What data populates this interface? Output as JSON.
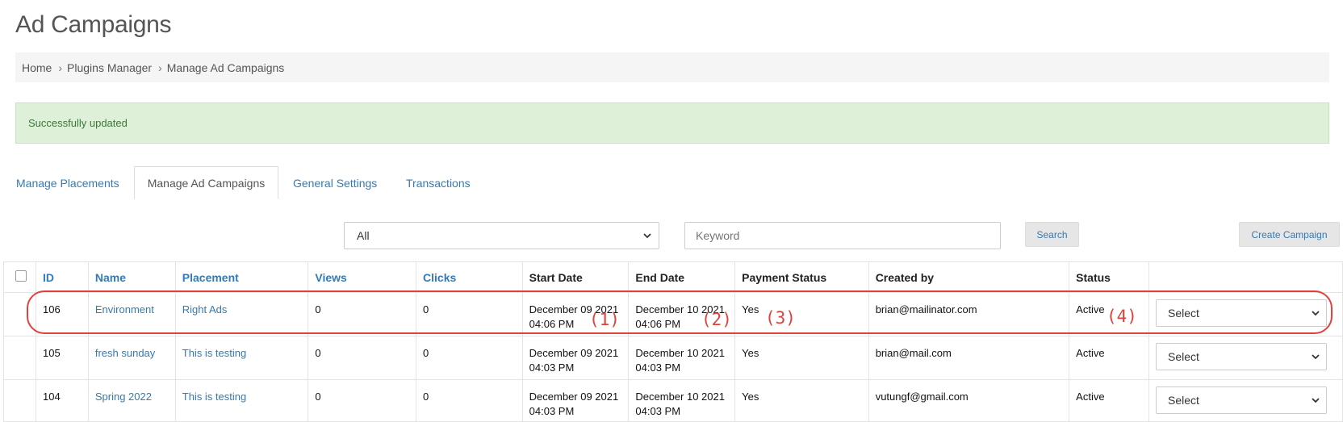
{
  "page": {
    "title": "Ad Campaigns"
  },
  "breadcrumb": {
    "items": [
      "Home",
      "Plugins Manager",
      "Manage Ad Campaigns"
    ],
    "separator": "›"
  },
  "alert": {
    "message": "Successfully updated",
    "color": "#dff0d8"
  },
  "tabs": [
    {
      "label": "Manage Placements",
      "active": false
    },
    {
      "label": "Manage Ad Campaigns",
      "active": true
    },
    {
      "label": "General Settings",
      "active": false
    },
    {
      "label": "Transactions",
      "active": false
    }
  ],
  "filters": {
    "status_select": {
      "value": "All"
    },
    "keyword": {
      "placeholder": "Keyword",
      "value": ""
    },
    "search_label": "Search",
    "create_label": "Create Campaign"
  },
  "table": {
    "headers": [
      "ID",
      "Name",
      "Placement",
      "Views",
      "Clicks",
      "Start Date",
      "End Date",
      "Payment Status",
      "Created by",
      "Status"
    ],
    "rows": [
      {
        "id": "106",
        "name": "Environment",
        "placement": "Right Ads",
        "views": "0",
        "clicks": "0",
        "start_date": "December 09 2021",
        "start_time": "04:06 PM",
        "end_date": "December 10 2021",
        "end_time": "04:06 PM",
        "payment": "Yes",
        "created_by": "brian@mailinator.com",
        "status": "Active",
        "action": "Select"
      },
      {
        "id": "105",
        "name": "fresh sunday",
        "placement": "This is testing",
        "views": "0",
        "clicks": "0",
        "start_date": "December 09 2021",
        "start_time": "04:03 PM",
        "end_date": "December 10 2021",
        "end_time": "04:03 PM",
        "payment": "Yes",
        "created_by": "brian@mail.com",
        "status": "Active",
        "action": "Select"
      },
      {
        "id": "104",
        "name": "Spring 2022",
        "placement": "This is testing",
        "views": "0",
        "clicks": "0",
        "start_date": "December 09 2021",
        "start_time": "04:03 PM",
        "end_date": "December 10 2021",
        "end_time": "04:03 PM",
        "payment": "Yes",
        "created_by": "vutungf@gmail.com",
        "status": "Active",
        "action": "Select"
      }
    ]
  },
  "annotations": {
    "color": "#e0413b",
    "labels": [
      "(1)",
      "(2)",
      "(3)",
      "(4)"
    ]
  },
  "colors": {
    "link": "#337ab7",
    "title": "#555555"
  }
}
